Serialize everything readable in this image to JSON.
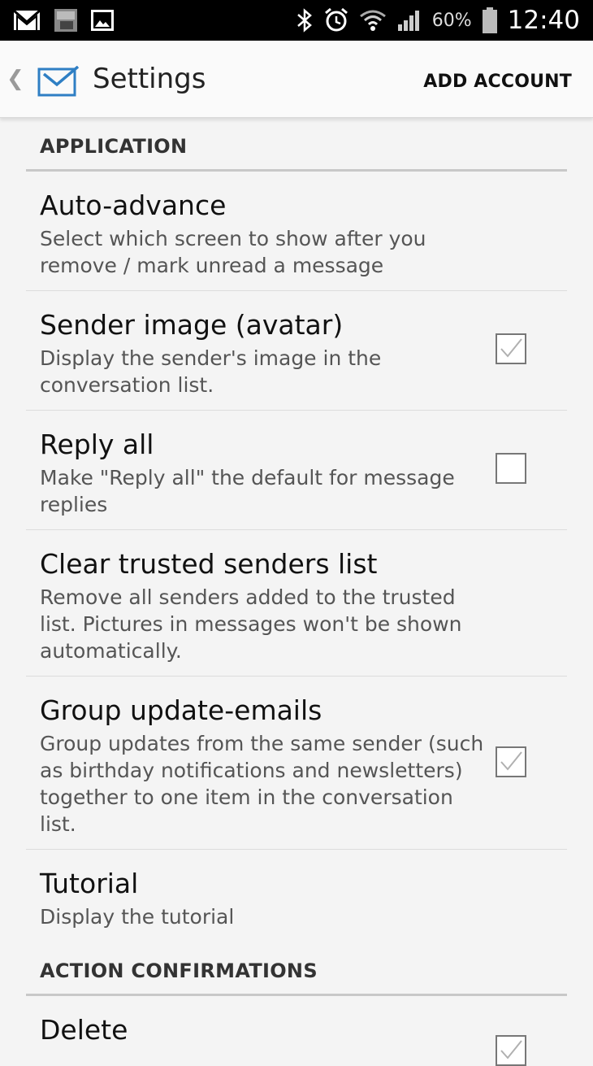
{
  "status_bar": {
    "left_icons": [
      "gmail-icon",
      "photo-notification-icon",
      "gallery-icon"
    ],
    "right_icons": [
      "bluetooth-icon",
      "alarm-icon",
      "wifi-icon",
      "signal-icon",
      "battery-icon"
    ],
    "battery_percent": "60%",
    "time": "12:40"
  },
  "action_bar": {
    "title": "Settings",
    "add_account_label": "ADD ACCOUNT",
    "app_icon": "mail-envelope-icon",
    "accent_color": "#2f7fc4"
  },
  "sections": [
    {
      "header": "APPLICATION",
      "items": [
        {
          "title": "Auto-advance",
          "summary": "Select which screen to show after you remove / mark unread a message",
          "checkbox": null
        },
        {
          "title": "Sender image (avatar)",
          "summary": "Display the sender's image in the conversation list.",
          "checkbox": true
        },
        {
          "title": "Reply all",
          "summary": "Make \"Reply all\" the default for message replies",
          "checkbox": false
        },
        {
          "title": "Clear trusted senders list",
          "summary": "Remove all senders added to the trusted list. Pictures in messages won't be shown automatically.",
          "checkbox": null
        },
        {
          "title": "Group update-emails",
          "summary": "Group updates from the same sender (such as birthday notifications and newsletters) together to one item in the conversation list.",
          "checkbox": true
        },
        {
          "title": "Tutorial",
          "summary": "Display the tutorial",
          "checkbox": null
        }
      ]
    },
    {
      "header": "ACTION CONFIRMATIONS",
      "items": [
        {
          "title": "Delete",
          "summary": "",
          "checkbox": true
        }
      ]
    }
  ]
}
